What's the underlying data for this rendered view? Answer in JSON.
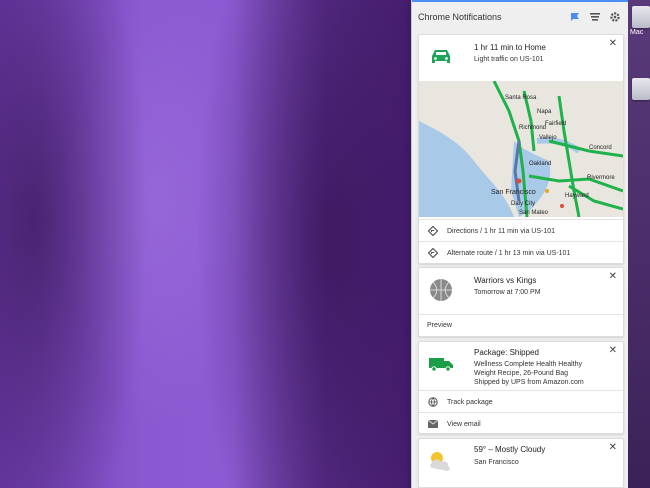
{
  "panel": {
    "title": "Chrome Notifications"
  },
  "traffic": {
    "title": "1 hr 11 min to Home",
    "subtitle": "Light traffic on US-101",
    "actions": [
      {
        "label": "Directions / 1 hr 11 min via US-101"
      },
      {
        "label": "Alternate route / 1 hr 13 min via US-101"
      }
    ],
    "map_labels": [
      "Santa Rosa",
      "Napa",
      "Fairfield",
      "Vallejo",
      "Oakland",
      "San Francisco",
      "Daly City",
      "Hayward",
      "San Mateo",
      "Rivermore",
      "Concord",
      "Richmond"
    ]
  },
  "sports": {
    "title": "Warriors vs Kings",
    "subtitle": "Tomorrow at 7:00 PM",
    "action": "Preview"
  },
  "package": {
    "title": "Package: Shipped",
    "line1": "Wellness Complete Health Healthy",
    "line2": "Weight Recipe, 26-Pound Bag",
    "line3": "Shipped by UPS from Amazon.com",
    "actions": [
      {
        "label": "Track package"
      },
      {
        "label": "View email"
      }
    ]
  },
  "weather": {
    "title": "59° – Mostly Cloudy",
    "subtitle": "San Francisco"
  },
  "desktop": {
    "icon_label": "Mac"
  },
  "colors": {
    "accent": "#4c8df5",
    "traffic_green": "#1da35a",
    "truck_green": "#1c9e48"
  }
}
